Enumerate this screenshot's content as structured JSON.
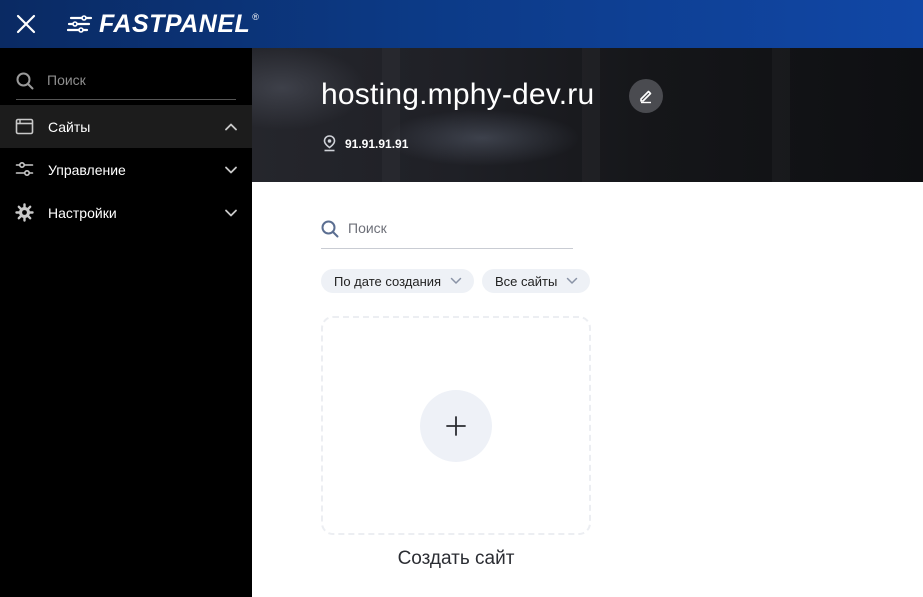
{
  "brand": {
    "name": "FASTPANEL",
    "reg": "®"
  },
  "sidebar": {
    "search_placeholder": "Поиск",
    "items": [
      {
        "label": "Сайты",
        "icon": "window-icon",
        "active": true,
        "expanded": true
      },
      {
        "label": "Управление",
        "icon": "sliders-icon",
        "active": false,
        "expanded": false
      },
      {
        "label": "Настройки",
        "icon": "gear-icon",
        "active": false,
        "expanded": false
      }
    ]
  },
  "header": {
    "site_title": "hosting.mphy-dev.ru",
    "ip": "91.91.91.91"
  },
  "main": {
    "search_placeholder": "Поиск",
    "sort_filter": "По дате создания",
    "type_filter": "Все сайты",
    "create_label": "Создать сайт"
  },
  "colors": {
    "topbar_start": "#0a2a63",
    "topbar_end": "#1147a6",
    "sidebar_bg": "#000000",
    "chip_bg": "#eef1f6"
  }
}
